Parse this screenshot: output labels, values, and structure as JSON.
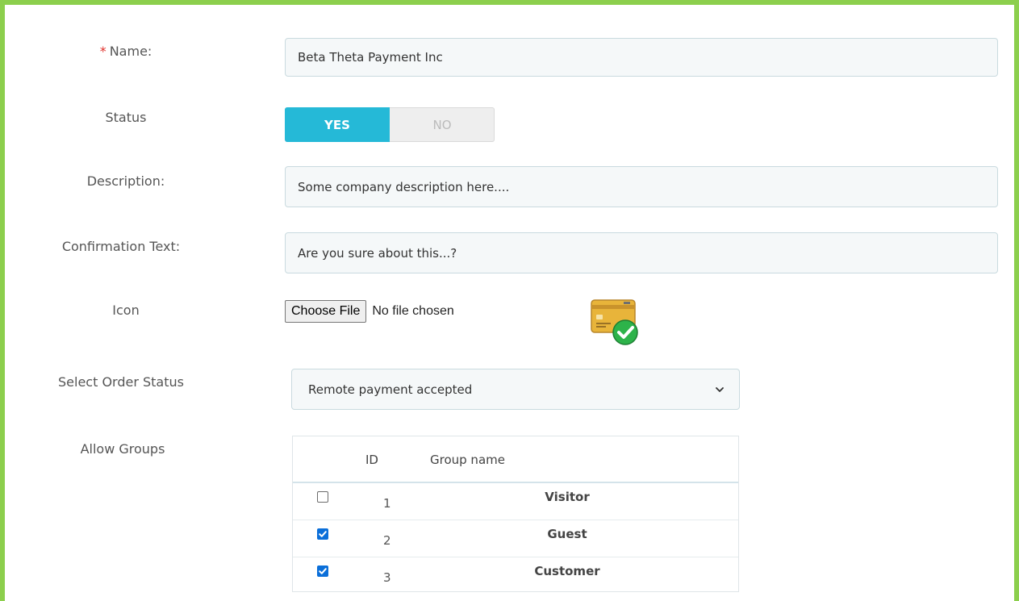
{
  "form": {
    "name_required_marker": "*",
    "name_label": "Name:",
    "name_value": "Beta Theta Payment Inc",
    "status_label": "Status",
    "status_yes": "YES",
    "status_no": "NO",
    "status_value": "YES",
    "description_label": "Description:",
    "description_value": "Some company description here....",
    "confirmation_label": "Confirmation Text:",
    "confirmation_value": "Are you sure about this...?",
    "icon_label": "Icon",
    "file_button": "Choose File",
    "file_status": "No file chosen",
    "order_status_label": "Select Order Status",
    "order_status_value": "Remote payment accepted",
    "groups_label": "Allow Groups"
  },
  "groups_table": {
    "col_id": "ID",
    "col_name": "Group name",
    "rows": [
      {
        "id": "1",
        "name": "Visitor",
        "checked": false
      },
      {
        "id": "2",
        "name": "Guest",
        "checked": true
      },
      {
        "id": "3",
        "name": "Customer",
        "checked": true
      }
    ]
  },
  "colors": {
    "frame": "#8ccf4d",
    "toggle_on": "#25b9d7",
    "required": "#e0302a",
    "checkbox": "#0b6fd9"
  },
  "icons": {
    "uploaded_icon": "card-check-icon",
    "select_arrow": "chevron-down-icon"
  }
}
